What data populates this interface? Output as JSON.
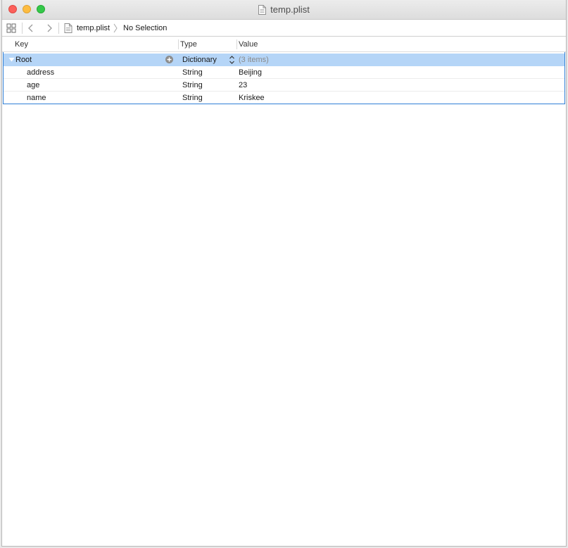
{
  "window": {
    "title": "temp.plist"
  },
  "jumpbar": {
    "crumbs": [
      {
        "label": "temp.plist"
      },
      {
        "label": "No Selection"
      }
    ]
  },
  "table": {
    "columns": {
      "key": "Key",
      "type": "Type",
      "value": "Value"
    },
    "root": {
      "key": "Root",
      "type": "Dictionary",
      "value": "(3 items)"
    },
    "rows": [
      {
        "key": "address",
        "type": "String",
        "value": "Beijing"
      },
      {
        "key": "age",
        "type": "String",
        "value": "23"
      },
      {
        "key": "name",
        "type": "String",
        "value": "Kriskee"
      }
    ]
  }
}
